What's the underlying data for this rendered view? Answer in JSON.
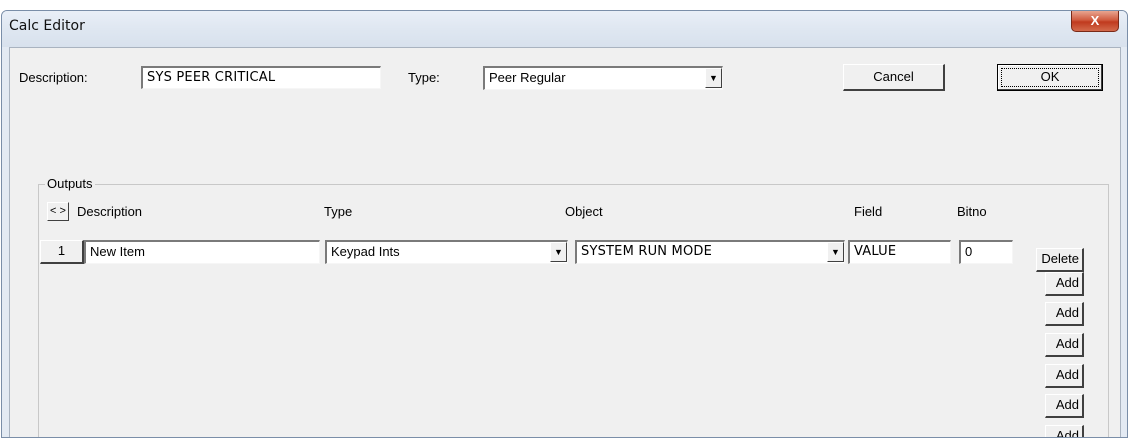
{
  "window": {
    "title": "Calc Editor",
    "close_glyph": "X"
  },
  "header": {
    "description_label": "Description:",
    "description_value": "SYS PEER CRITICAL",
    "type_label": "Type:",
    "type_value": "Peer Regular",
    "cancel_label": "Cancel",
    "ok_label": "OK"
  },
  "outputs": {
    "group_label": "Outputs",
    "nav_glyph": "< >",
    "columns": [
      "Description",
      "Type",
      "Object",
      "Field",
      "Bitno"
    ],
    "rows": [
      {
        "index": "1",
        "description": "New Item",
        "type": "Keypad Ints",
        "object": "SYSTEM RUN MODE",
        "field": "VALUE",
        "bitno": "0"
      }
    ],
    "delete_label": "Delete",
    "add_labels": [
      "Add",
      "Add",
      "Add",
      "Add",
      "Add",
      "Add"
    ]
  },
  "icons": {
    "dropdown": "chevron-down-icon",
    "close": "close-icon"
  },
  "colors": {
    "face": "#f0f0f0",
    "close_red": "#c03a1e",
    "frame": "#e3eaf3"
  }
}
